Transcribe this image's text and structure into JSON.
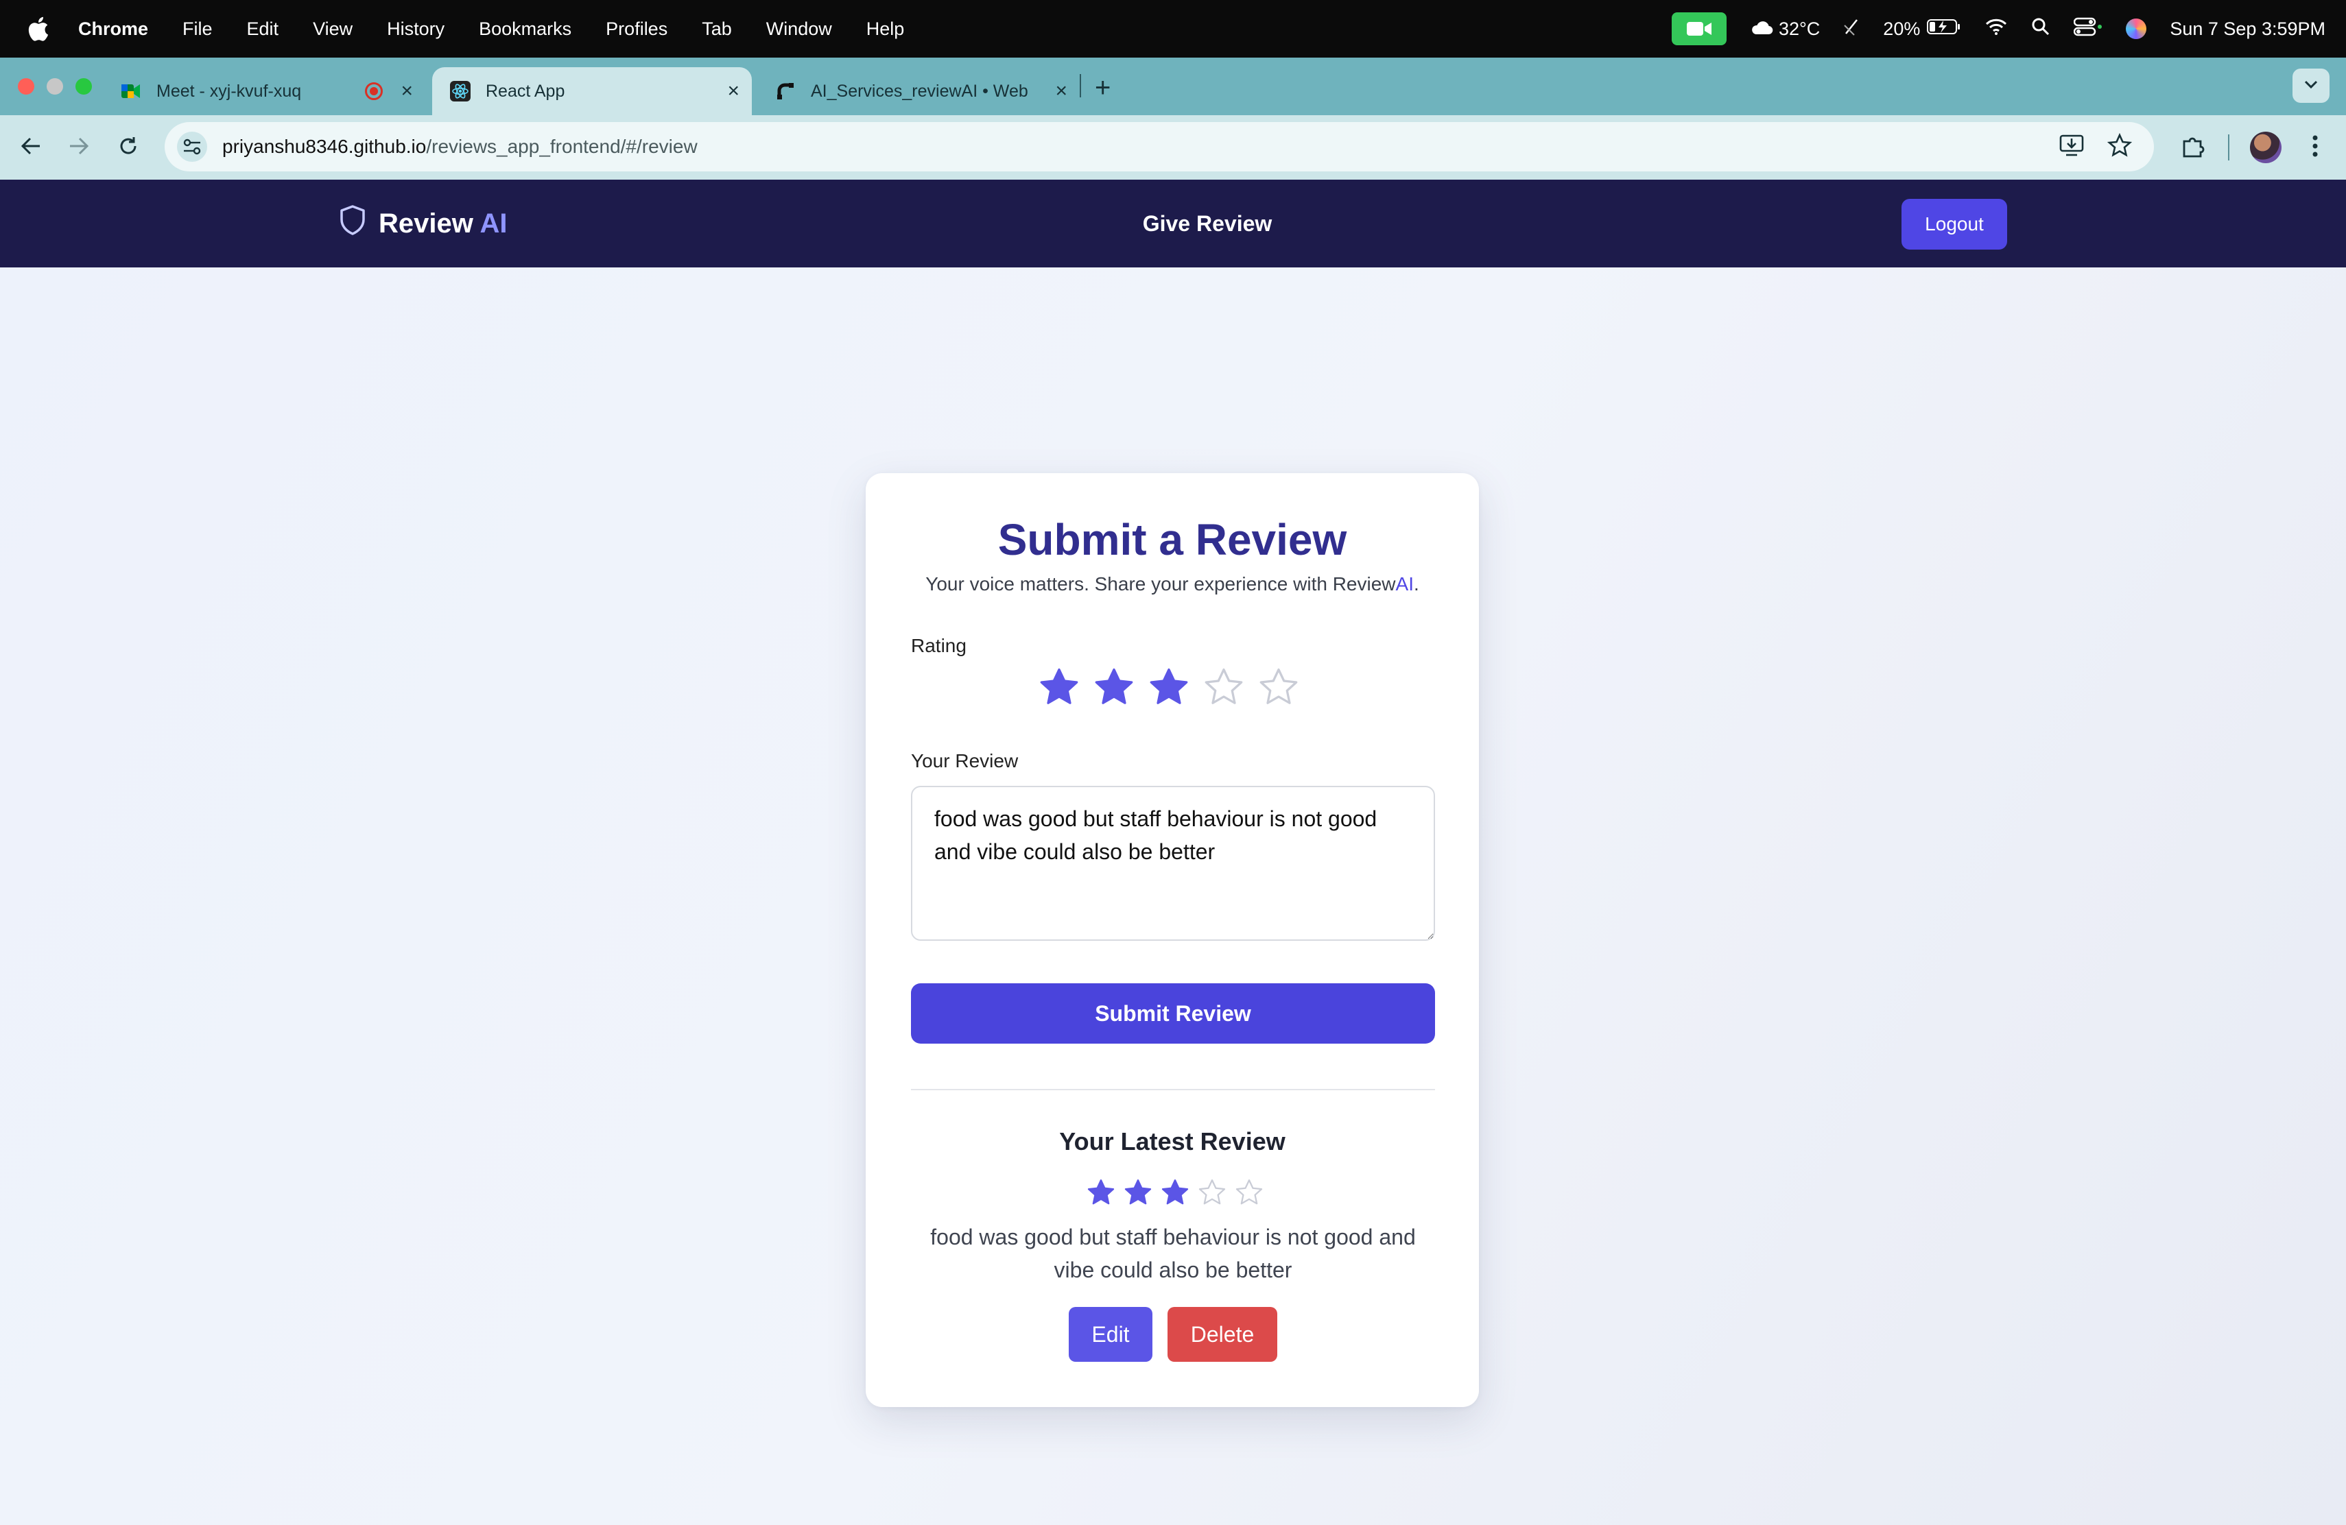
{
  "menubar": {
    "app_name": "Chrome",
    "items": [
      "File",
      "Edit",
      "View",
      "History",
      "Bookmarks",
      "Profiles",
      "Tab",
      "Window",
      "Help"
    ],
    "temperature": "32°C",
    "battery": "20%",
    "datetime": "Sun 7 Sep  3:59PM"
  },
  "tabs": [
    {
      "label": "Meet - xyj-kvuf-xuq",
      "icon": "google-meet-icon",
      "recording": true
    },
    {
      "label": "React App",
      "icon": "react-icon",
      "active": true
    },
    {
      "label": "AI_Services_reviewAI • Web",
      "icon": "render-icon"
    }
  ],
  "address_bar": {
    "domain": "priyanshu8346.github.io",
    "path": "/reviews_app_frontend/#/review"
  },
  "app": {
    "brand_main": "Review",
    "brand_accent": "AI",
    "nav_link": "Give Review",
    "logout_label": "Logout"
  },
  "form": {
    "title": "Submit a Review",
    "subtitle_main": "Your voice matters. Share your experience with Review",
    "subtitle_accent": "AI",
    "subtitle_end": ".",
    "rating_label": "Rating",
    "rating": 3,
    "rating_max": 5,
    "review_label": "Your Review",
    "review_value": "food was good but staff behaviour is not good and vibe could also be better",
    "submit_label": "Submit Review"
  },
  "latest": {
    "title": "Your Latest Review",
    "rating": 3,
    "rating_max": 5,
    "text": "food was good but staff behaviour is not good and vibe could also be better",
    "edit_label": "Edit",
    "delete_label": "Delete"
  },
  "colors": {
    "primary": "#4f46e5",
    "nav_bg": "#1d1b4b",
    "title": "#312e8f",
    "danger": "#dc4a4a",
    "star_filled": "#5b55e6",
    "star_empty": "#c9ccd6"
  }
}
